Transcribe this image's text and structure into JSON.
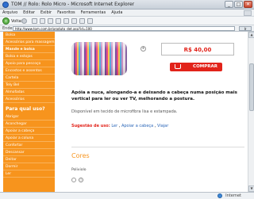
{
  "window": {
    "title": "TOM // Rolo: Rolo Micro - Microsoft Internet Explorer",
    "min_label": "_",
    "max_label": "□",
    "close_label": "✕"
  },
  "menu": {
    "items": [
      "Arquivo",
      "Editar",
      "Exibir",
      "Favoritos",
      "Ferramentas",
      "Ajuda"
    ]
  },
  "toolbar": {
    "back_label": "Voltar"
  },
  "address": {
    "label": "Endereço",
    "url": "http://www.tom.com.br/produto_det.asp?id=100",
    "go_label": "Ir"
  },
  "sidebar": {
    "items": [
      {
        "label": "Bolsa",
        "bold": false
      },
      {
        "label": "Acessórios para massagem",
        "bold": false
      },
      {
        "label": "Mande e bolsa",
        "bold": true
      },
      {
        "label": "Bolsa e estojos",
        "bold": false
      },
      {
        "label": "Apoio para pescoço",
        "bold": false
      },
      {
        "label": "Encostos e assentos",
        "bold": false
      },
      {
        "label": "Cartela",
        "bold": false
      },
      {
        "label": "Tely Bel",
        "bold": false
      },
      {
        "label": "Almofadas",
        "bold": false
      },
      {
        "label": "Acessórios",
        "bold": false
      }
    ],
    "heading": "Para qual uso?",
    "uses": [
      "Abrigar",
      "Aconchegar",
      "Apoiar a cabeça",
      "Apoiar a coluna",
      "Confortar",
      "Descansar",
      "Deitar",
      "Dormir",
      "Ler"
    ]
  },
  "product": {
    "price": "R$ 40,00",
    "buy_label": "COMPRAR",
    "zoom_label": "+",
    "description_title": "Apóia a nuca, alongando-a e deixando a cabeça numa posição mais vertical para ler ou ver TV, melhorando a postura.",
    "description_text": "Disponível em tecido de microfibra lisa e estampada.",
    "usage_label": "Sugestão de uso:",
    "usage_links": [
      "Ler",
      "Apoiar a cabeça",
      "Viajar"
    ]
  },
  "colors": {
    "title": "Cores",
    "name": "Poliviolo",
    "info_label": "i"
  },
  "status": {
    "left": "",
    "zone": "Internet"
  },
  "scroll": {
    "up": "▲",
    "down": "▼"
  }
}
